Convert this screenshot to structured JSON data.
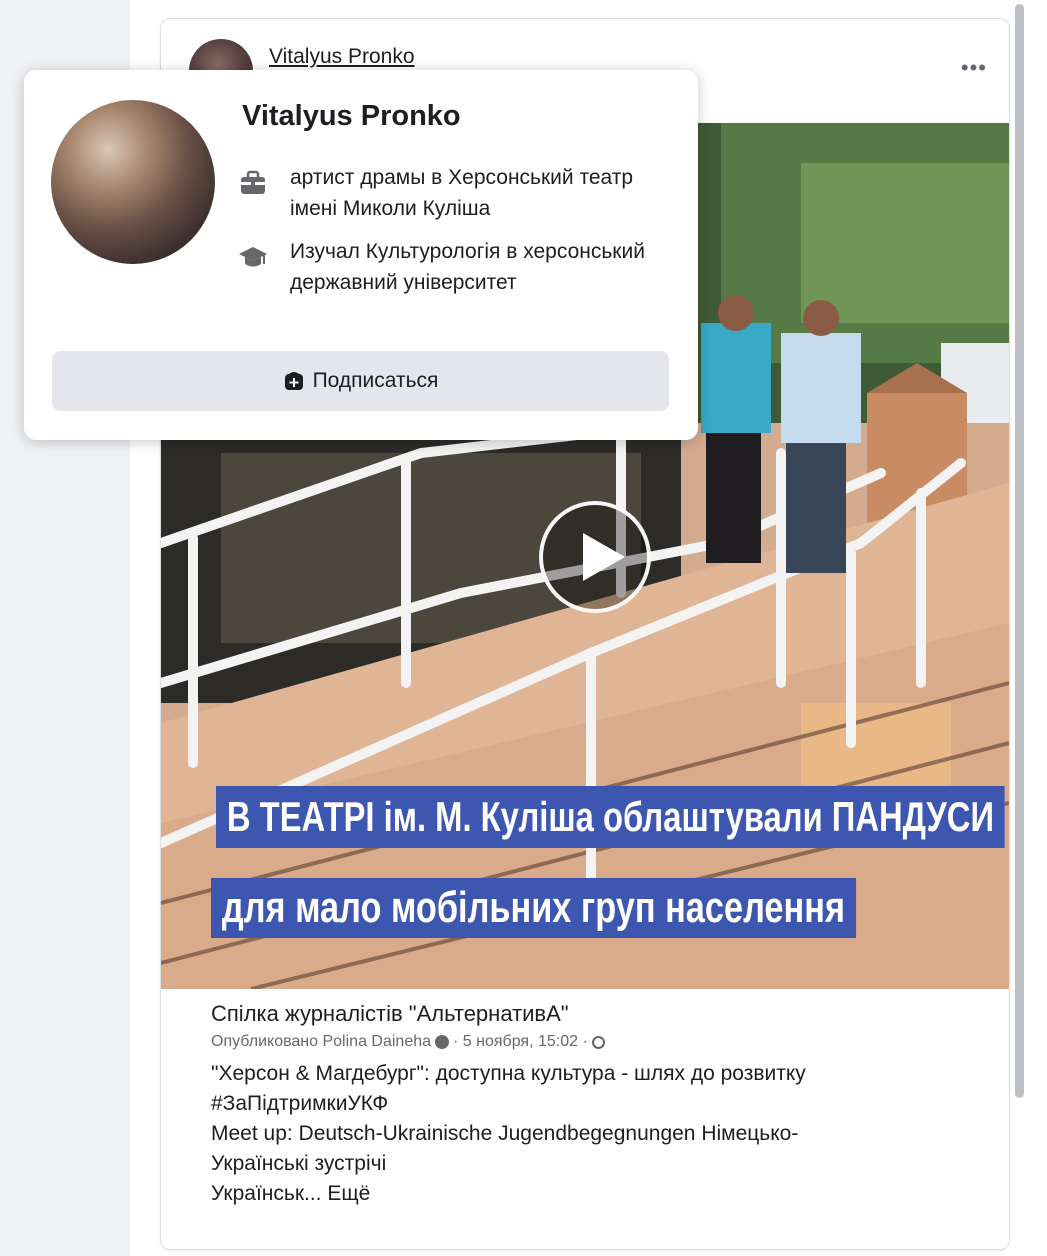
{
  "post": {
    "author": "Vitalyus Pronko",
    "more_label": "•••"
  },
  "video": {
    "caption_line1": "В ТЕАТРІ ім. М. Куліша облаштували ПАНДУСИ",
    "caption_line2": "для мало мобільних груп населення"
  },
  "shared": {
    "page_name": "Спілка журналістів \"АльтернативА\"",
    "meta_prefix": "Опубликовано Polina Daineha",
    "meta_time": "· 5 ноября, 15:02 ·",
    "desc_line1": "\"Херсон & Магдебург\": доступна культура - шлях до розвитку",
    "desc_line2": "#ЗаПідтримкиУКФ",
    "desc_line3": "Meet up: Deutsch-Ukrainische Jugendbegegnungen Німецько-",
    "desc_line4": "Українські зустрічі",
    "desc_line5_prefix": "Українськ...",
    "desc_more": "Ещё"
  },
  "hover_card": {
    "name": "Vitalyus Pronko",
    "work": "артист драмы в Херсонський театр імені Миколи Куліша",
    "education": "Изучал Культурологія в херсонський державний університет",
    "follow_label": "Подписаться"
  },
  "colors": {
    "caption_bg": "#3d56b0",
    "button_bg": "#e4e6eb",
    "sidebar_bg": "#f0f2f5"
  },
  "icons": {
    "work": "briefcase-icon",
    "education": "graduation-cap-icon",
    "follow": "follow-plus-icon",
    "play": "play-icon",
    "globe": "globe-icon"
  }
}
